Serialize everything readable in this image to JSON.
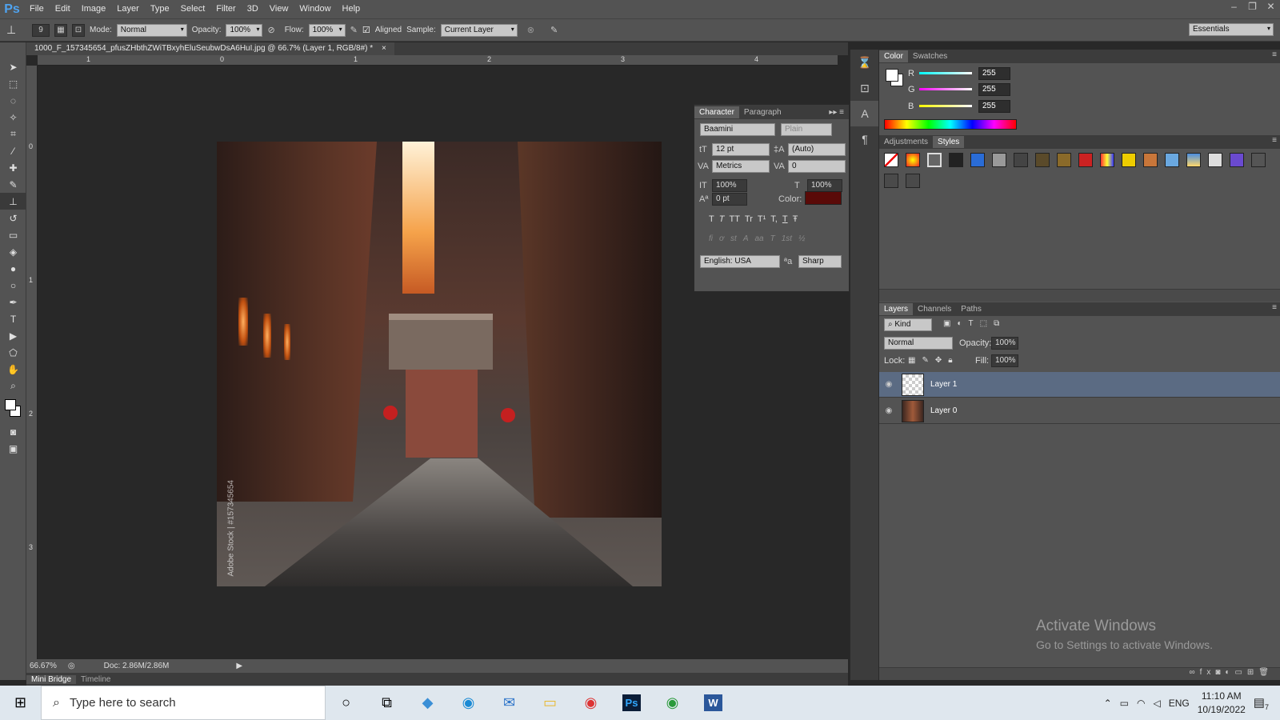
{
  "app": {
    "logo": "Ps"
  },
  "menu": [
    "File",
    "Edit",
    "Image",
    "Layer",
    "Type",
    "Select",
    "Filter",
    "3D",
    "View",
    "Window",
    "Help"
  ],
  "window_controls": [
    "‒",
    "❐",
    "✕"
  ],
  "options": {
    "brush_size": "9",
    "mode_label": "Mode:",
    "mode_value": "Normal",
    "opacity_label": "Opacity:",
    "opacity_value": "100%",
    "flow_label": "Flow:",
    "flow_value": "100%",
    "aligned_label": "Aligned",
    "sample_label": "Sample:",
    "sample_value": "Current Layer",
    "workspace": "Essentials"
  },
  "document": {
    "tab_title": "1000_F_157345654_pfusZHbthZWiTBxyhEluSeubwDsA6HuI.jpg @ 66.7% (Layer 1, RGB/8#) *",
    "tab_close": "×",
    "watermark_text": "Adobe Stock | #157345654"
  },
  "rulers": {
    "h_ticks": [
      "1",
      "0",
      "1",
      "2",
      "3",
      "4"
    ],
    "v_ticks": [
      "0",
      "1",
      "2",
      "3"
    ]
  },
  "status": {
    "zoom": "66.67%",
    "doc": "Doc: 2.86M/2.86M"
  },
  "bottom_tabs": [
    "Mini Bridge",
    "Timeline"
  ],
  "character": {
    "tabs": [
      "Character",
      "Paragraph"
    ],
    "font_family": "Baamini",
    "font_style": "Plain",
    "size": "12 pt",
    "leading": "(Auto)",
    "kerning": "Metrics",
    "tracking": "0",
    "vscale": "100%",
    "hscale": "100%",
    "baseline": "0 pt",
    "color_label": "Color:",
    "color_value": "#5a0a08",
    "style_buttons": [
      "T",
      "T",
      "TT",
      "Tr",
      "T¹",
      "T,",
      "T",
      "Ŧ"
    ],
    "opentype_buttons": [
      "fi",
      "ơ",
      "st",
      "A",
      "aa",
      "T",
      "1st",
      "½"
    ],
    "language": "English: USA",
    "aa_icon": "ªa",
    "antialias": "Sharp"
  },
  "color_panel": {
    "tabs": [
      "Color",
      "Swatches"
    ],
    "r_label": "R",
    "r_value": "255",
    "g_label": "G",
    "g_value": "255",
    "b_label": "B",
    "b_value": "255"
  },
  "styles_panel": {
    "tabs": [
      "Adjustments",
      "Styles"
    ]
  },
  "layers_panel": {
    "tabs": [
      "Layers",
      "Channels",
      "Paths"
    ],
    "filter_kind": "Kind",
    "blend_mode": "Normal",
    "opacity_label": "Opacity:",
    "opacity_value": "100%",
    "lock_label": "Lock:",
    "fill_label": "Fill:",
    "fill_value": "100%",
    "layers": [
      {
        "name": "Layer 1",
        "selected": true
      },
      {
        "name": "Layer 0",
        "selected": false
      }
    ]
  },
  "activate": {
    "title": "Activate Windows",
    "subtitle": "Go to Settings to activate Windows."
  },
  "taskbar": {
    "search_placeholder": "Type here to search",
    "time": "11:10 AM",
    "date": "10/19/2022",
    "lang": "ENG",
    "notif_count": "7"
  }
}
